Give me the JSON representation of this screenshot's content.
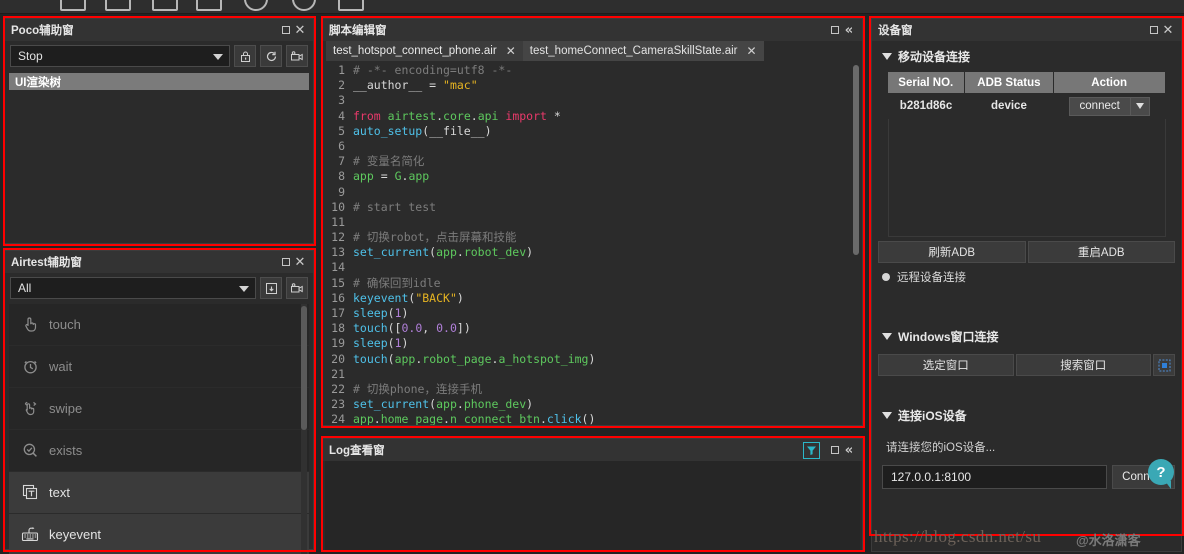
{
  "toolbar": {
    "icons": [
      "new-script-icon",
      "save-icon",
      "folder-icon",
      "save-as-icon",
      "run-icon",
      "stop-icon",
      "report-icon"
    ]
  },
  "poco": {
    "title": "Poco辅助窗",
    "mode_value": "Stop",
    "buttons": [
      {
        "name": "lock-icon",
        "label": "lock"
      },
      {
        "name": "refresh-icon",
        "label": "refresh"
      },
      {
        "name": "record-icon",
        "label": "record"
      }
    ],
    "tree_header": "UI渲染树",
    "restore_label": "□",
    "close_label": "✕"
  },
  "airtest": {
    "title": "Airtest辅助窗",
    "filter_value": "All",
    "buttons": [
      {
        "name": "insert-snapshot-icon",
        "label": "insert"
      },
      {
        "name": "record-icon",
        "label": "record"
      }
    ],
    "items": [
      {
        "label": "touch",
        "icon": "touch-icon",
        "state": "dim"
      },
      {
        "label": "wait",
        "icon": "clock-icon",
        "state": "dim"
      },
      {
        "label": "swipe",
        "icon": "swipe-icon",
        "state": "dim"
      },
      {
        "label": "exists",
        "icon": "search-check-icon",
        "state": "dim"
      },
      {
        "label": "text",
        "icon": "text-icon",
        "state": "bright"
      },
      {
        "label": "keyevent",
        "icon": "keyboard-icon",
        "state": "bright"
      }
    ],
    "restore_label": "□",
    "close_label": "✕"
  },
  "editor": {
    "title": "脚本编辑窗",
    "restore_label": "□",
    "collapse_label": "«",
    "tabs": [
      {
        "label": "test_hotspot_connect_phone.air",
        "active": true,
        "close": "✕"
      },
      {
        "label": "test_homeConnect_CameraSkillState.air",
        "active": false,
        "close": "✕"
      }
    ],
    "code_lines": [
      {
        "n": "1",
        "text": "# -*- encoding=utf8 -*-"
      },
      {
        "n": "2",
        "text": "__author__ = \"mac\""
      },
      {
        "n": "3",
        "text": ""
      },
      {
        "n": "4",
        "text": "from airtest.core.api import *"
      },
      {
        "n": "5",
        "text": "auto_setup(__file__)"
      },
      {
        "n": "6",
        "text": ""
      },
      {
        "n": "7",
        "text": "# 变量名简化"
      },
      {
        "n": "8",
        "text": "app = G.app"
      },
      {
        "n": "9",
        "text": ""
      },
      {
        "n": "10",
        "text": "# start test"
      },
      {
        "n": "11",
        "text": ""
      },
      {
        "n": "12",
        "text": "# 切换robot，点击屏幕和技能"
      },
      {
        "n": "13",
        "text": "set_current(app.robot_dev)"
      },
      {
        "n": "14",
        "text": ""
      },
      {
        "n": "15",
        "text": "# 确保回到idle"
      },
      {
        "n": "16",
        "text": "keyevent(\"BACK\")"
      },
      {
        "n": "17",
        "text": "sleep(1)"
      },
      {
        "n": "18",
        "text": "touch([0.0, 0.0])"
      },
      {
        "n": "19",
        "text": "sleep(1)"
      },
      {
        "n": "20",
        "text": "touch(app.robot_page.a_hotspot_img)"
      },
      {
        "n": "21",
        "text": ""
      },
      {
        "n": "22",
        "text": "# 切换phone，连接手机"
      },
      {
        "n": "23",
        "text": "set_current(app.phone_dev)"
      },
      {
        "n": "24",
        "text": "app.home_page.n_connect_btn.click()"
      }
    ]
  },
  "log": {
    "title": "Log查看窗",
    "filter_icon": "filter-icon",
    "restore_label": "□",
    "collapse_label": "«"
  },
  "device": {
    "title": "设备窗",
    "restore_label": "□",
    "close_label": "✕",
    "mobile_section": "移动设备连接",
    "table": {
      "headers": [
        "Serial NO.",
        "ADB Status",
        "Action"
      ],
      "rows": [
        {
          "serial": "b281d86c",
          "status": "device",
          "action": "connect"
        }
      ]
    },
    "adb_buttons": [
      "刷新ADB",
      "重启ADB"
    ],
    "remote_section": "远程设备连接",
    "windows_section": "Windows窗口连接",
    "windows_buttons": [
      "选定窗口",
      "搜索窗口"
    ],
    "windows_picker_icon": "target-picker-icon",
    "ios_section": "连接iOS设备",
    "ios_hint": "请连接您的iOS设备...",
    "ios_address": "127.0.0.1:8100",
    "ios_connect_label": "Connect",
    "help_label": "?"
  },
  "watermark": {
    "url": "https://blog.csdn.net/su",
    "user": "@水洛潇客"
  }
}
